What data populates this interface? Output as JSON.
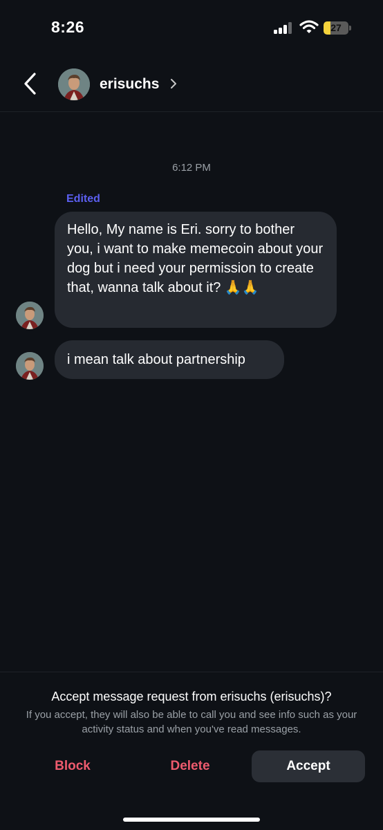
{
  "status_bar": {
    "time": "8:26",
    "battery_level": "27",
    "battery_color": "#f5d33c"
  },
  "header": {
    "back_icon": "chevron-left-icon",
    "username": "erisuchs",
    "profile_chevron_icon": "chevron-right-icon"
  },
  "conversation": {
    "timestamp": "6:12 PM",
    "edited_label": "Edited",
    "messages": [
      {
        "text": "Hello, My name is Eri. sorry to bother you, i want to make memecoin about your dog but i need your permission to create that, wanna talk about it? 🙏🙏"
      },
      {
        "text": "i mean talk about partnership"
      }
    ]
  },
  "request": {
    "title": "Accept message request from erisuchs (erisuchs)?",
    "description": "If you accept, they will also be able to call you and see info such as your activity status and when you've read messages.",
    "block_label": "Block",
    "delete_label": "Delete",
    "accept_label": "Accept",
    "danger_color": "#ee5b6e",
    "accent_color": "#5b5ff0"
  }
}
